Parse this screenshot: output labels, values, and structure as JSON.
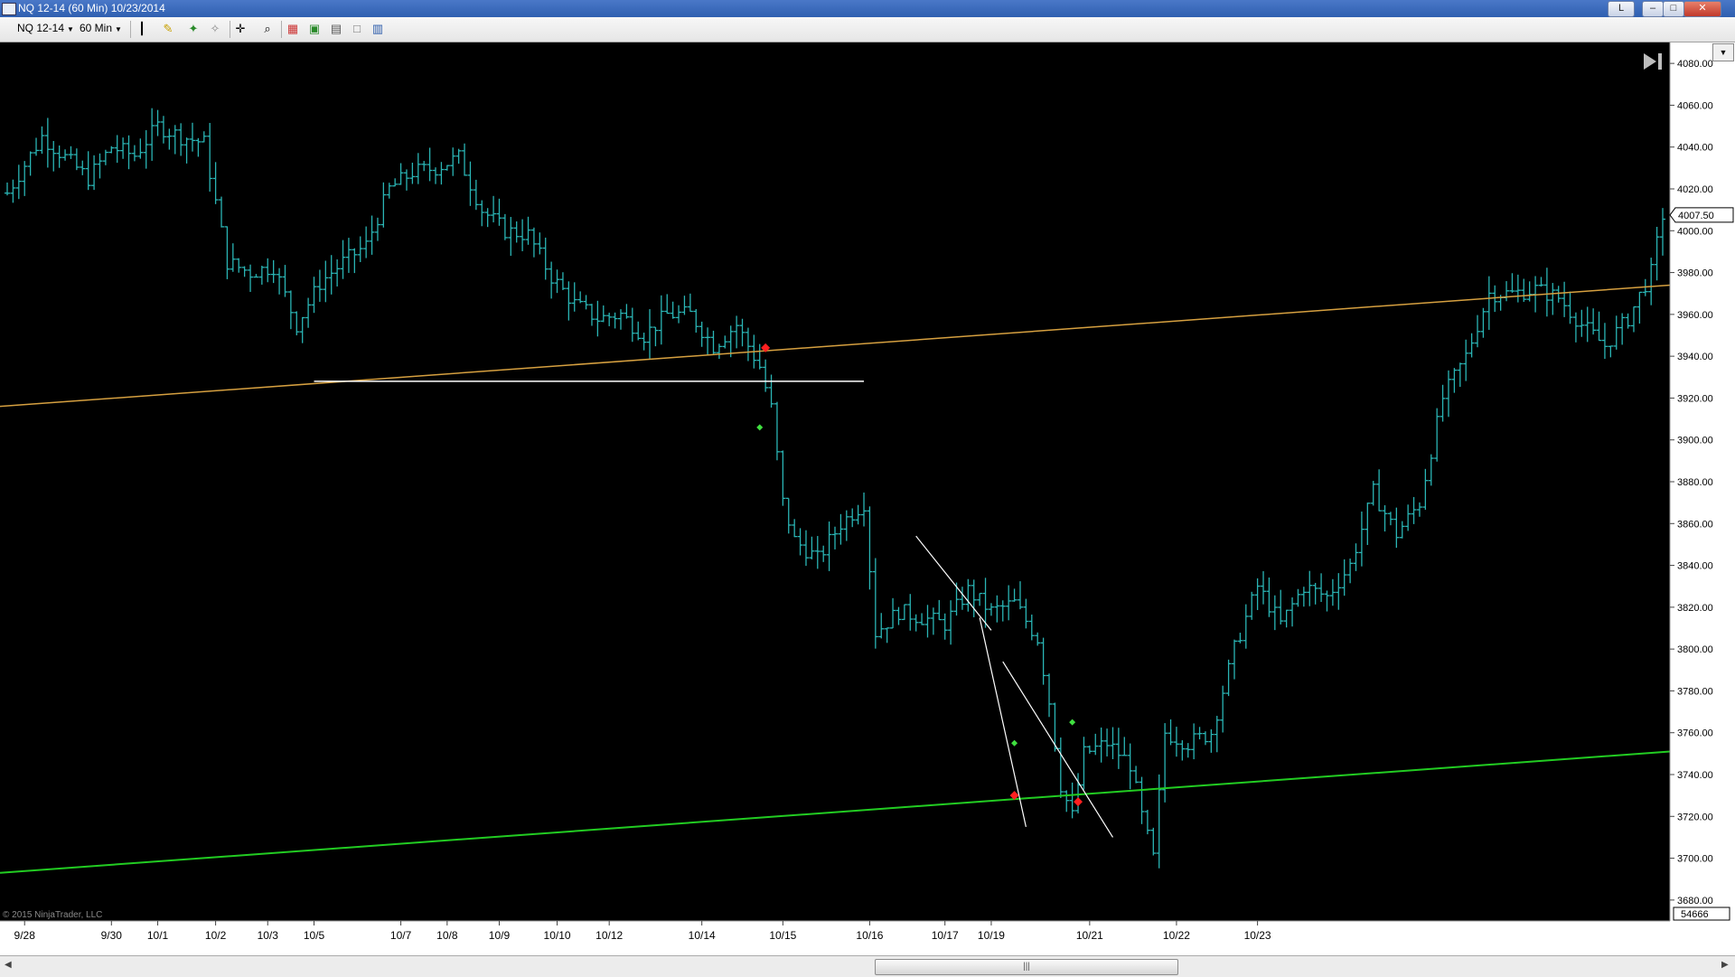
{
  "window": {
    "title": "NQ 12-14 (60 Min)  10/23/2014",
    "buttons": {
      "link": "L"
    }
  },
  "toolbar": {
    "instrument": "NQ 12-14",
    "interval": "60 Min"
  },
  "chart": {
    "copyright": "© 2015 NinjaTrader, LLC",
    "last_price_label": "4007.50",
    "volume_label": "54666",
    "colors": {
      "background": "#000000",
      "bars": "#2ab5b5",
      "upper_trend": "#d6a040",
      "lower_trend": "#22cc22",
      "lines": "#ffffff",
      "red_marker": "#ff2020",
      "green_marker": "#40e040"
    }
  },
  "chart_data": {
    "type": "ohlc",
    "ylim": [
      3670,
      4090
    ],
    "y_ticks": [
      "4080.00",
      "4060.00",
      "4040.00",
      "4020.00",
      "4000.00",
      "3980.00",
      "3960.00",
      "3940.00",
      "3920.00",
      "3900.00",
      "3880.00",
      "3860.00",
      "3840.00",
      "3820.00",
      "3800.00",
      "3780.00",
      "3760.00",
      "3740.00",
      "3720.00",
      "3700.00",
      "3680.00"
    ],
    "x_ticks": [
      "9/28",
      "9/30",
      "10/1",
      "10/2",
      "10/3",
      "10/5",
      "10/7",
      "10/8",
      "10/9",
      "10/10",
      "10/12",
      "10/14",
      "10/15",
      "10/16",
      "10/17",
      "10/19",
      "10/21",
      "10/22",
      "10/23"
    ],
    "bars_close_path": [
      [
        0,
        4018
      ],
      [
        6,
        4045
      ],
      [
        10,
        4035
      ],
      [
        14,
        4025
      ],
      [
        18,
        4040
      ],
      [
        22,
        4036
      ],
      [
        26,
        4050
      ],
      [
        30,
        4045
      ],
      [
        34,
        4042
      ],
      [
        38,
        3985
      ],
      [
        42,
        3980
      ],
      [
        46,
        3983
      ],
      [
        50,
        3955
      ],
      [
        54,
        3975
      ],
      [
        58,
        3985
      ],
      [
        62,
        3993
      ],
      [
        66,
        4020
      ],
      [
        70,
        4028
      ],
      [
        74,
        4030
      ],
      [
        78,
        4035
      ],
      [
        82,
        4010
      ],
      [
        86,
        4000
      ],
      [
        90,
        3998
      ],
      [
        94,
        3978
      ],
      [
        98,
        3965
      ],
      [
        102,
        3958
      ],
      [
        106,
        3960
      ],
      [
        110,
        3950
      ],
      [
        114,
        3960
      ],
      [
        118,
        3960
      ],
      [
        122,
        3945
      ],
      [
        126,
        3955
      ],
      [
        130,
        3935
      ],
      [
        132,
        3915
      ],
      [
        134,
        3870
      ],
      [
        136,
        3852
      ],
      [
        140,
        3843
      ],
      [
        144,
        3860
      ],
      [
        148,
        3870
      ],
      [
        150,
        3808
      ],
      [
        154,
        3818
      ],
      [
        158,
        3815
      ],
      [
        162,
        3812
      ],
      [
        166,
        3828
      ],
      [
        170,
        3818
      ],
      [
        174,
        3822
      ],
      [
        178,
        3805
      ],
      [
        180,
        3775
      ],
      [
        182,
        3735
      ],
      [
        184,
        3720
      ],
      [
        186,
        3750
      ],
      [
        190,
        3755
      ],
      [
        194,
        3745
      ],
      [
        196,
        3720
      ],
      [
        198,
        3700
      ],
      [
        200,
        3760
      ],
      [
        204,
        3755
      ],
      [
        208,
        3760
      ],
      [
        212,
        3800
      ],
      [
        216,
        3830
      ],
      [
        220,
        3812
      ],
      [
        224,
        3830
      ],
      [
        228,
        3825
      ],
      [
        232,
        3840
      ],
      [
        236,
        3875
      ],
      [
        240,
        3855
      ],
      [
        244,
        3870
      ],
      [
        248,
        3920
      ],
      [
        252,
        3940
      ],
      [
        256,
        3970
      ],
      [
        260,
        3970
      ],
      [
        264,
        3972
      ],
      [
        268,
        3968
      ],
      [
        272,
        3955
      ],
      [
        276,
        3945
      ],
      [
        280,
        3958
      ],
      [
        284,
        3980
      ],
      [
        286,
        4007.5
      ]
    ],
    "bar_range_half": 9,
    "total_bars": 287,
    "annotations": {
      "upper_trend": [
        [
          0,
          3916
        ],
        [
          287,
          3974
        ]
      ],
      "lower_trend": [
        [
          0,
          3693
        ],
        [
          287,
          3751
        ]
      ],
      "support_line": {
        "from": 53,
        "to": 148,
        "y": 3928
      },
      "down_trend_lines": [
        [
          [
            157,
            3854
          ],
          [
            170,
            3809
          ]
        ],
        [
          [
            168,
            3815
          ],
          [
            176,
            3715
          ]
        ],
        [
          [
            172,
            3794
          ],
          [
            191,
            3710
          ]
        ]
      ],
      "red_markers": [
        [
          131,
          3944
        ],
        [
          174,
          3730
        ],
        [
          185,
          3727
        ]
      ],
      "green_markers": [
        [
          130,
          3906
        ],
        [
          174,
          3755
        ],
        [
          184,
          3765
        ]
      ]
    }
  }
}
